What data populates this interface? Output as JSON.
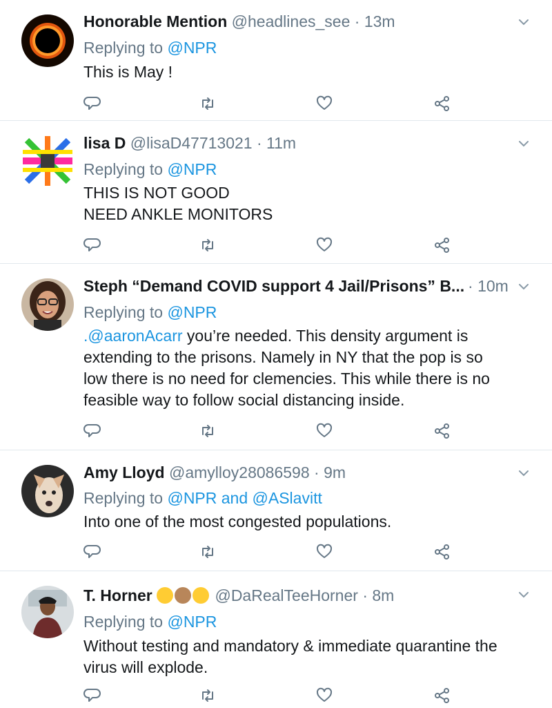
{
  "tweets": [
    {
      "name": "Honorable Mention",
      "handle": "@headlines_see",
      "time": "13m",
      "replying_prefix": "Replying to",
      "replying_to": "@NPR",
      "body_lines": [
        "This is May !"
      ]
    },
    {
      "name": "lisa D",
      "handle": "@lisaD47713021",
      "time": "11m",
      "replying_prefix": "Replying to",
      "replying_to": "@NPR",
      "body_lines": [
        "THIS IS NOT GOOD",
        "NEED ANKLE MONITORS"
      ]
    },
    {
      "name": "Steph “Demand COVID support 4 Jail/Prisons” B...",
      "handle": "",
      "time": "10m",
      "replying_prefix": "Replying to",
      "replying_to": "@NPR",
      "mention": ".@aaronAcarr",
      "body_first_rest": " you’re needed. This density argument is",
      "body_lines": [
        "extending to the prisons. Namely in NY that the pop is so",
        "low there is no need for clemencies. This while there is no",
        "feasible way to follow social distancing inside."
      ]
    },
    {
      "name": "Amy Lloyd",
      "handle": "@amylloy28086598",
      "time": "9m",
      "replying_prefix": "Replying to",
      "replying_to": "@NPR and @ASlavitt",
      "body_lines": [
        "Into one of the most congested populations."
      ]
    },
    {
      "name": "T. Horner",
      "handle": "@DaRealTeeHorner",
      "time": "8m",
      "replying_prefix": "Replying to",
      "replying_to": "@NPR",
      "name_emojis": [
        "zany-face-emoji",
        "cookie-emoji",
        "expressionless-face-emoji"
      ],
      "body_lines": [
        "Without testing and mandatory & immediate quarantine the",
        "virus will explode."
      ]
    }
  ],
  "separator": "·",
  "icons": {
    "reply": "reply-icon",
    "retweet": "retweet-icon",
    "like": "heart-icon",
    "share": "share-icon",
    "caret": "chevron-down-icon"
  },
  "colors": {
    "link": "#1b95e0",
    "secondary": "#657786",
    "text": "#14171a",
    "divider": "#e1e8ed"
  }
}
